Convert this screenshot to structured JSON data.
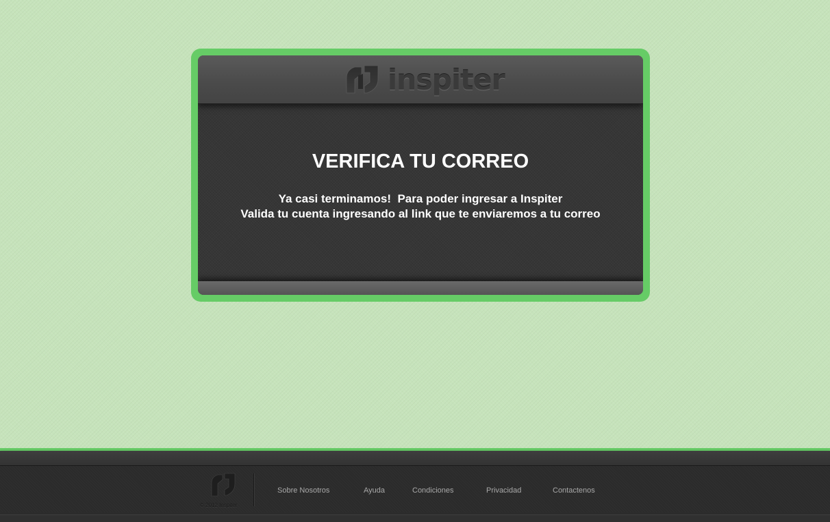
{
  "brand": {
    "name": "inspiter",
    "logo_icon": "inspiter-logo-icon"
  },
  "card": {
    "title": "VERIFICA TU CORREO",
    "message_line_1": "Ya casi terminamos!  Para poder ingresar a Inspiter",
    "message_line_2": "Valida tu cuenta ingresando al link que te enviaremos a tu correo"
  },
  "footer": {
    "copyright": "© 2012 Inspiter",
    "links": [
      {
        "label": "Sobre Nosotros"
      },
      {
        "label": "Ayuda"
      },
      {
        "label": "Condiciones"
      },
      {
        "label": "Privacidad"
      },
      {
        "label": "Contactenos"
      }
    ]
  },
  "colors": {
    "page_background": "#c6e3bb",
    "accent_green": "#66cc66",
    "card_dark": "#363636",
    "footer_dark": "#2c2c2c",
    "title_text": "#ffffff",
    "footer_link_text": "#a9a9a9"
  }
}
